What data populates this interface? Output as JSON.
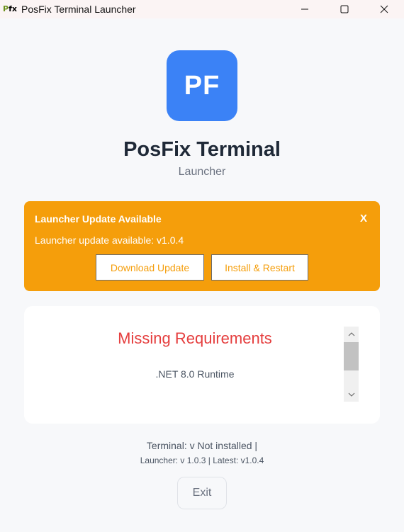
{
  "window": {
    "title": "PosFix Terminal Launcher",
    "icon_text": "Pfx",
    "controls": [
      "minimize-icon",
      "maximize-icon",
      "close-icon"
    ]
  },
  "header": {
    "logo_text": "PF",
    "logo_color": "#3b82f6",
    "title": "PosFix Terminal",
    "subtitle": "Launcher"
  },
  "update": {
    "title": "Launcher Update Available",
    "close_label": "X",
    "message": "Launcher update available: v1.0.4",
    "download_label": "Download Update",
    "install_label": "Install & Restart",
    "color": "#f59e0b"
  },
  "requirements": {
    "title": "Missing Requirements",
    "title_color": "#e53e3e",
    "items": [
      ".NET 8.0 Runtime"
    ]
  },
  "footer": {
    "terminal_line": "Terminal: v Not installed  |",
    "launcher_line": "Launcher: v 1.0.3  |  Latest: v1.0.4",
    "exit_label": "Exit"
  }
}
